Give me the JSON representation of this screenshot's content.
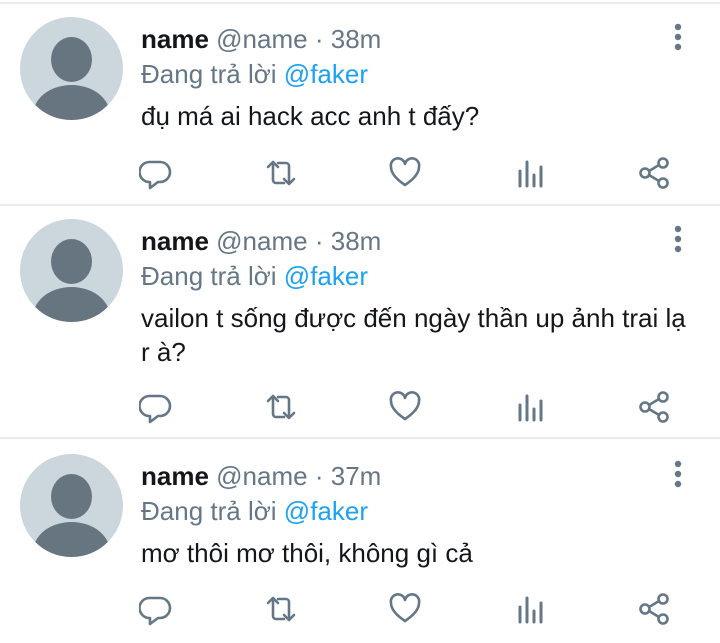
{
  "tweets": [
    {
      "display_name": "name",
      "handle": "@name",
      "separator": "·",
      "time": "38m",
      "reply_prefix": "Đang trả lời",
      "reply_to": "@faker",
      "text": "đụ má ai hack acc anh t đấy?"
    },
    {
      "display_name": "name",
      "handle": "@name",
      "separator": "·",
      "time": "38m",
      "reply_prefix": "Đang trả lời",
      "reply_to": "@faker",
      "text": "vailon t sống được đến ngày thần up ảnh trai lạ r à?"
    },
    {
      "display_name": "name",
      "handle": "@name",
      "separator": "·",
      "time": "37m",
      "reply_prefix": "Đang trả lời",
      "reply_to": "@faker",
      "text": "mơ thôi mơ thôi, không gì cả"
    }
  ],
  "icons": {
    "reply": "reply-icon",
    "retweet": "retweet-icon",
    "like": "heart-icon",
    "views": "analytics-icon",
    "share": "share-icon",
    "more": "more-vertical-icon"
  },
  "colors": {
    "text_primary": "#14171a",
    "text_secondary": "#657786",
    "link": "#1da1f2",
    "avatar_bg": "#ccd6dd",
    "avatar_fg": "#66757f",
    "divider": "#e6ecf0"
  }
}
